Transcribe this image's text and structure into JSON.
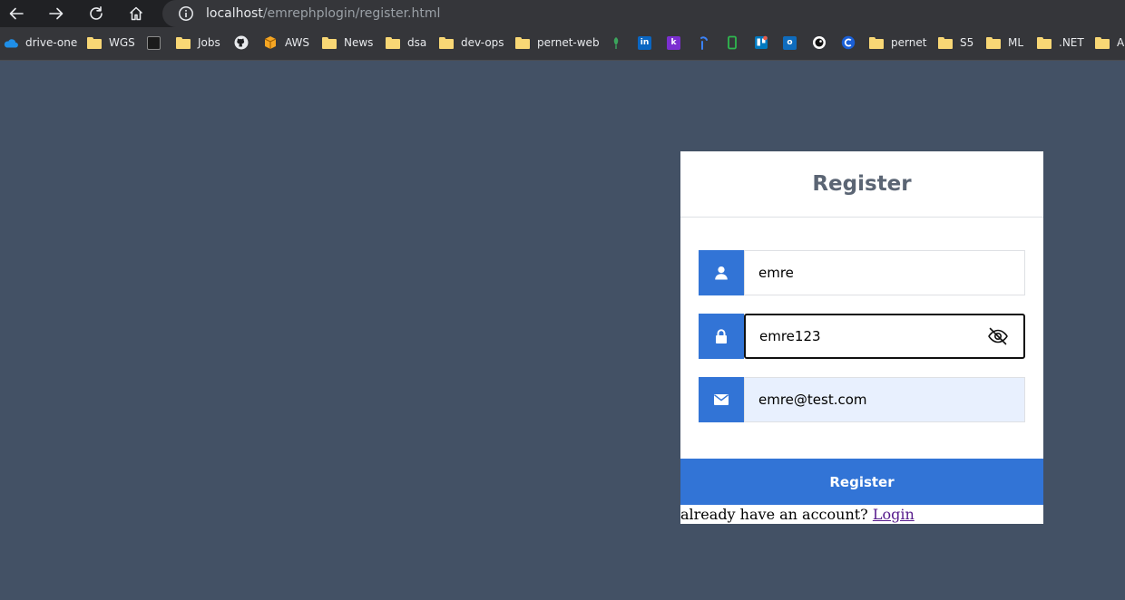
{
  "browser": {
    "url_host": "localhost",
    "url_path": "/emrephplogin/register.html",
    "nav": {
      "back_icon": "back-arrow-icon",
      "forward_icon": "forward-arrow-icon",
      "reload_icon": "reload-icon",
      "home_icon": "home-icon"
    },
    "bookmarks": [
      {
        "label": "drive-one",
        "icon": "onedrive-cloud-icon"
      },
      {
        "label": "WGS",
        "icon": "folder-icon"
      },
      {
        "label": "",
        "icon": "bookmark-dark-icon"
      },
      {
        "label": "Jobs",
        "icon": "folder-icon"
      },
      {
        "label": "",
        "icon": "github-icon"
      },
      {
        "label": "AWS",
        "icon": "aws-box-icon"
      },
      {
        "label": "News",
        "icon": "folder-icon"
      },
      {
        "label": "dsa",
        "icon": "folder-icon"
      },
      {
        "label": "dev-ops",
        "icon": "folder-icon"
      },
      {
        "label": "pernet-web",
        "icon": "folder-icon"
      },
      {
        "label": "",
        "icon": "leaf-icon"
      },
      {
        "label": "",
        "icon": "linkedin-icon"
      },
      {
        "label": "",
        "icon": "k-icon"
      },
      {
        "label": "",
        "icon": "blue-mark-icon"
      },
      {
        "label": "",
        "icon": "green-phone-icon"
      },
      {
        "label": "",
        "icon": "trello-icon"
      },
      {
        "label": "",
        "icon": "outlook-icon"
      },
      {
        "label": "",
        "icon": "circle-dark-icon"
      },
      {
        "label": "",
        "icon": "c-icon"
      },
      {
        "label": "pernet",
        "icon": "folder-icon"
      },
      {
        "label": "S5",
        "icon": "folder-icon"
      },
      {
        "label": "ML",
        "icon": "folder-icon"
      },
      {
        "label": ".NET",
        "icon": "folder-icon"
      },
      {
        "label": "A",
        "icon": "folder-icon"
      }
    ]
  },
  "register": {
    "title": "Register",
    "username": {
      "value": "emre",
      "icon": "user-icon"
    },
    "password": {
      "value": "emre123",
      "icon": "lock-icon",
      "toggle_icon": "eye-slash-icon"
    },
    "email": {
      "value": "emre@test.com",
      "icon": "envelope-icon"
    },
    "submit_label": "Register",
    "footer_text": "already have an account? ",
    "login_link": "Login"
  },
  "colors": {
    "page_background": "#435165",
    "accent": "#3274d6",
    "title_text": "#5b6574",
    "autofill_background": "#e8f0fe",
    "visited_link": "#551a8b"
  }
}
